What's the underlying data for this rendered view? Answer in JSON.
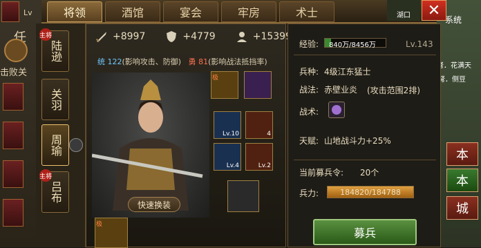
{
  "tabs": [
    {
      "label": "将领",
      "active": true
    },
    {
      "label": "酒馆",
      "active": false
    },
    {
      "label": "宴会",
      "active": false
    },
    {
      "label": "牢房",
      "active": false
    },
    {
      "label": "术士",
      "active": false
    }
  ],
  "left_panel": {
    "label_ren": "任",
    "label_defeat": "击败关",
    "level": "Lv"
  },
  "minimap": {
    "label": "湖口"
  },
  "right_strip": {
    "label": "系统",
    "buttons": [
      "本",
      "本",
      "城"
    ],
    "top_text": "弩．花满天",
    "text2": "弩．侧豆"
  },
  "heroes": [
    {
      "name": "陆逊",
      "main": true,
      "main_tag": "主将",
      "selected": false
    },
    {
      "name": "关羽",
      "main": false,
      "selected": false
    },
    {
      "name": "周瑜",
      "main": false,
      "selected": true
    },
    {
      "name": "吕布",
      "main": true,
      "main_tag": "主将",
      "selected": false
    }
  ],
  "stats": {
    "attack": "+8997",
    "defense": "+4779",
    "troops": "+15399"
  },
  "sub_stats": {
    "tong_label": "统 122",
    "tong_desc": "(影响攻击、防御)",
    "yong_label": "勇 81",
    "yong_desc": "(影响战法抵挡率)"
  },
  "quick_equip_label": "快速换装",
  "equips": [
    {
      "icon": "armor-icon",
      "lv": "",
      "tag": "极"
    },
    {
      "icon": "ring-icon",
      "lv": ""
    },
    {
      "icon": "weapon-icon",
      "lv": "Lv.10"
    },
    {
      "icon": "fire-sword-icon",
      "lv": "4"
    },
    {
      "icon": "bow-icon",
      "lv": "Lv.4"
    },
    {
      "icon": "warrior-icon",
      "lv": "Lv.2"
    },
    {
      "icon": "mount-icon",
      "lv": ""
    },
    {
      "icon": "tiger-icon",
      "lv": "",
      "tag": "极"
    }
  ],
  "right_info": {
    "exp_label": "经验:",
    "exp_value": "840万/8456万",
    "exp_progress": 0.0993,
    "level": "Lv.143",
    "bing_label": "兵种:",
    "bing_value": "4级江东猛士",
    "zhanfa_label": "战法:",
    "zhanfa_value": "赤壁业炎",
    "zhanfa_desc": "(攻击范围2排)",
    "zhanshu_label": "战术:",
    "tianfu_label": "天赋:",
    "tianfu_value": "山地战斗力+25%",
    "recruit_token_label": "当前募兵令:",
    "recruit_token_value": "20个",
    "hp_label": "兵力:",
    "hp_value": "184820/184788",
    "hp_progress": 1.0,
    "recruit_button": "募兵"
  },
  "colors": {
    "accent_gold": "#c8a060",
    "close_red": "#d03020",
    "recruit_green": "#5a9040",
    "purple_text": "#c080ff"
  }
}
